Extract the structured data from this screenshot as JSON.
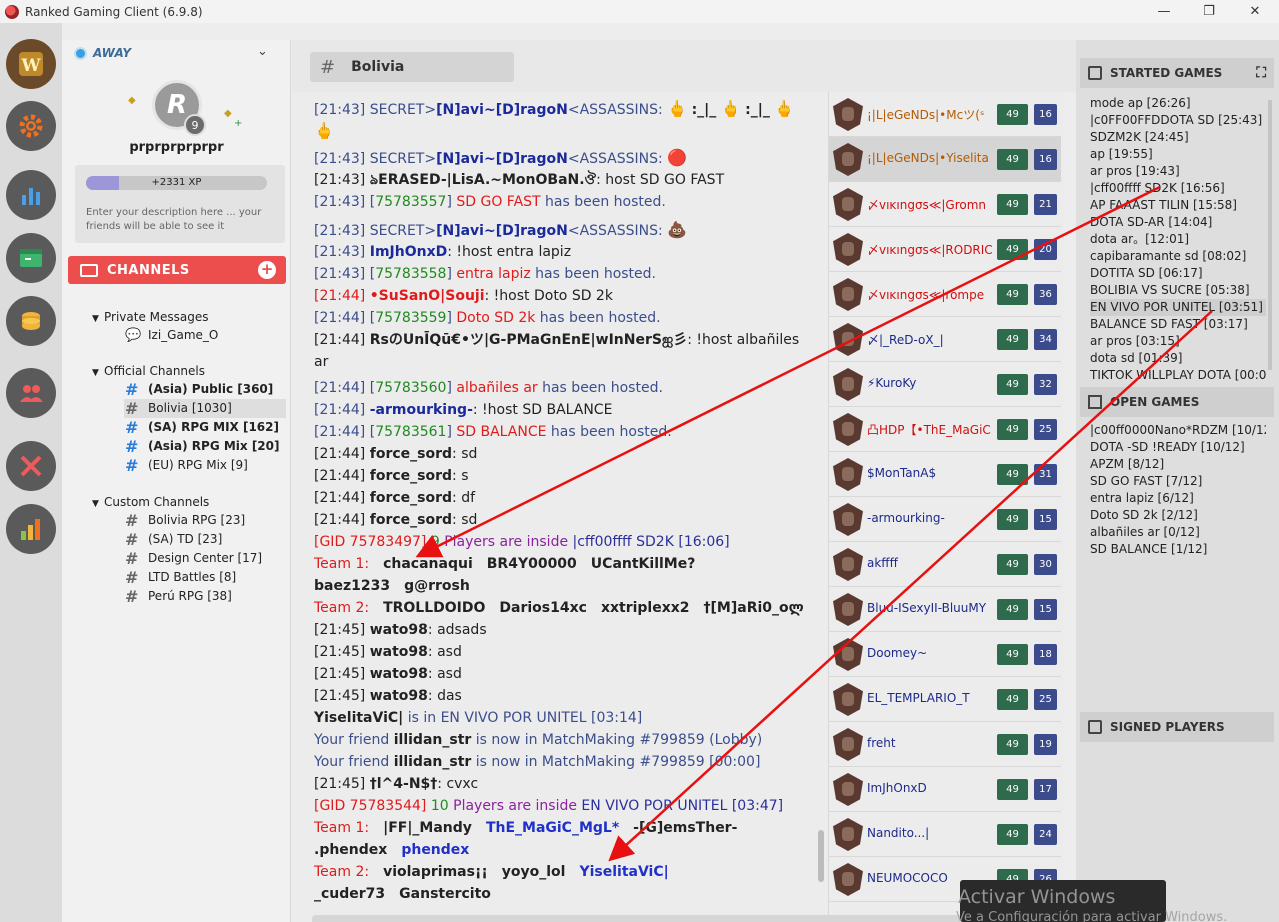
{
  "window": {
    "title": "Ranked Gaming Client (6.9.8)",
    "minimize": "—",
    "maximize": "❐",
    "close": "✕"
  },
  "profile": {
    "status": "AWAY",
    "avatar_letter": "R",
    "level": "9",
    "username": "prprprprprpr",
    "xp": "+2331 XP",
    "xp_progress": 0.18,
    "description_placeholder": "Enter your description here ... your friends will be able to see it"
  },
  "channels": {
    "header": "CHANNELS",
    "add": "+",
    "groups": [
      {
        "title": "Private Messages",
        "items": [
          "Izi_Game_O"
        ]
      },
      {
        "title": "Official Channels",
        "items": [
          "(Asia) Public [360]",
          "Bolivia [1030]",
          "(SA) RPG MIX [162]",
          "(Asia) RPG Mix [20]",
          "(EU) RPG Mix [9]"
        ]
      },
      {
        "title": "Custom Channels",
        "items": [
          "Bolivia RPG [23]",
          "(SA) TD [23]",
          "Design Center [17]",
          "LTD Battles [8]",
          "Perú RPG [38]"
        ]
      }
    ]
  },
  "chat": {
    "channel": "Bolivia",
    "hash": "#",
    "lines": {
      "l1a": "[21:43] SECRET>",
      "l1b": "[N]avi~[D]ragoN",
      "l1c": "<ASSASSINS:",
      "l1d": ":_|_",
      "l1e": ":_|_",
      "l2a": "[21:43] SECRET>",
      "l2b": "[N]avi~[D]ragoN",
      "l2c": "<ASSASSINS:",
      "l3a": "[21:43] ",
      "l3b": "ঌERASED-|LisA.~MonOBaN.ঔ",
      "l3c": ": host SD GO FAST",
      "l4a": "[21:43] [",
      "l4b": "75783557",
      "l4c": "] ",
      "l4d": "SD GO FAST",
      "l4e": " has been hosted.",
      "l5a": "[21:43] SECRET>",
      "l5b": "[N]avi~[D]ragoN",
      "l5c": "<ASSASSINS:",
      "l6a": "[21:43] ",
      "l6b": "ImJhOnxD",
      "l6c": ": !host entra lapiz",
      "l7a": "[21:43] [",
      "l7b": "75783558",
      "l7c": "] ",
      "l7d": "entra lapiz",
      "l7e": " has been hosted.",
      "l8a": "[21:44] ",
      "l8b": "•SuSanO|Souji",
      "l8c": ": !host Doto SD 2k",
      "l9a": "[21:44] [",
      "l9b": "75783559",
      "l9c": "] ",
      "l9d": "Doto SD 2k",
      "l9e": " has been hosted.",
      "l10a": "[21:44] ",
      "l10b": "RsのUnĪQū€•ツ|G-PMaGnEnE|wInNerSஐ彡",
      "l10c": ": !host albañiles ar",
      "l11a": "[21:44] [",
      "l11b": "75783560",
      "l11c": "] ",
      "l11d": "albañiles ar",
      "l11e": " has been hosted.",
      "l12a": "[21:44] ",
      "l12b": "-armourking-",
      "l12c": ": !host SD BALANCE",
      "l13a": "[21:44] [",
      "l13b": "75783561",
      "l13c": "] ",
      "l13d": "SD BALANCE",
      "l13e": " has been hosted.",
      "l14a": "[21:44] ",
      "l14b": "force_sord",
      "l14c": ": sd",
      "l15a": "[21:44] ",
      "l15b": "force_sord",
      "l15c": ": s",
      "l16a": "[21:44] ",
      "l16b": "force_sord",
      "l16c": ": df",
      "l17a": "[21:44] ",
      "l17b": "force_sord",
      "l17c": ": sd",
      "l18a": "[GID 75783497] ",
      "l18b": "9",
      "l18c": " Players are inside ",
      "l18d": "|cff00ffff ",
      "l18e": "SD2K",
      "l18f": " [16:06]",
      "l19a": "Team 1:",
      "l19b": "chacanaqui",
      "l19c": "BR4Y00000",
      "l19d": "UCantKillMe?",
      "l20a": "baez1233",
      "l20b": "g@rrosh",
      "l21a": "Team 2:",
      "l21b": "TROLLDOIDO",
      "l21c": "Darios14xc",
      "l21d": "xxtriplexx2",
      "l21e": "†[M]aRi0_oლ",
      "l22a": "[21:45] ",
      "l22b": "wato98",
      "l22c": ": adsads",
      "l23a": "[21:45] ",
      "l23b": "wato98",
      "l23c": ": asd",
      "l24a": "[21:45] ",
      "l24b": "wato98",
      "l24c": ": asd",
      "l25a": "[21:45] ",
      "l25b": "wato98",
      "l25c": ": das",
      "l26a": "YiselitaViC|",
      "l26b": " is in EN VIVO POR UNITEL [03:14]",
      "l27a": "Your friend ",
      "l27b": "illidan_str",
      "l27c": " is now in MatchMaking #799859 (Lobby)",
      "l28a": "Your friend ",
      "l28b": "illidan_str",
      "l28c": " is now in MatchMaking #799859 [00:00]",
      "l29a": "[21:45] ",
      "l29b": "†l^4-N$†",
      "l29c": ": cvxc",
      "l30a": "[GID 75783544] ",
      "l30b": "10",
      "l30c": " Players are inside ",
      "l30d": "EN VIVO POR UNITEL",
      "l30e": " [03:47]",
      "l31a": "Team 1:",
      "l31b": "|FF|_Mandy",
      "l31c": "ThE_MaGiC_MgL*",
      "l31d": "-[G]emsTher-",
      "l32a": ".phendex",
      "l32b": "phendex",
      "l33a": "Team 2:",
      "l33b": "violaprimas¡¡",
      "l33c": "yoyo_lol",
      "l33d": "YiselitaViC|",
      "l34a": "_cuder73",
      "l34b": "Ganstercito"
    }
  },
  "users": [
    {
      "name": "¡|L|eGeNDs|•Mcツ(ˢ",
      "color": "orange",
      "level": "49",
      "rank": "16"
    },
    {
      "name": "¡|L|eGeNDs|•Yiselita",
      "color": "orange",
      "level": "49",
      "rank": "16"
    },
    {
      "name": "〆vıĸıngσѕ≪|Gromn",
      "color": "red",
      "level": "49",
      "rank": "21"
    },
    {
      "name": "〆vıĸıngσѕ≪|RODRIC",
      "color": "red",
      "level": "49",
      "rank": "20"
    },
    {
      "name": "〆vıĸıngσѕ≪|rompe",
      "color": "red",
      "level": "49",
      "rank": "36"
    },
    {
      "name": "〆|_ReD-oX_|",
      "color": "blue",
      "level": "49",
      "rank": "34"
    },
    {
      "name": "⚡KuroKy",
      "color": "blue",
      "level": "49",
      "rank": "32"
    },
    {
      "name": "凸HDP【•ThE_MaGiC",
      "color": "red",
      "level": "49",
      "rank": "25"
    },
    {
      "name": "$MonTanA$",
      "color": "blue",
      "level": "49",
      "rank": "31"
    },
    {
      "name": "-armourking-",
      "color": "blue",
      "level": "49",
      "rank": "15"
    },
    {
      "name": "akffff",
      "color": "blue",
      "level": "49",
      "rank": "30"
    },
    {
      "name": "Bluu-ISexyII-BluuMY",
      "color": "blue",
      "level": "49",
      "rank": "15"
    },
    {
      "name": "Doomey~",
      "color": "blue",
      "level": "49",
      "rank": "18"
    },
    {
      "name": "EL_TEMPLARIO_T",
      "color": "blue",
      "level": "49",
      "rank": "25"
    },
    {
      "name": "freht",
      "color": "blue",
      "level": "49",
      "rank": "19"
    },
    {
      "name": "ImJhOnxD",
      "color": "blue",
      "level": "49",
      "rank": "17"
    },
    {
      "name": "Nandito...|",
      "color": "blue",
      "level": "49",
      "rank": "24"
    },
    {
      "name": "NEUMOCOCO",
      "color": "blue",
      "level": "49",
      "rank": "26"
    }
  ],
  "games": {
    "started_title": "STARTED GAMES",
    "started": [
      "mode ap [26:26]",
      "|c0FF00FFDDOTA SD [25:43]",
      "SDZM2K [24:45]",
      "ap [19:55]",
      "ar pros [19:43]",
      "|cff00ffff SD2K [16:56]",
      "AP FAAAST TILIN [15:58]",
      "DOTA SD-AR [14:04]",
      "dota ar。[12:01]",
      "capibaramante sd [08:02]",
      "DOTITA SD [06:17]",
      "BOLIBIA VS SUCRE [05:38]",
      "EN VIVO POR UNITEL [03:51]",
      "BALANCE SD FAST [03:17]",
      "ar pros [03:15]",
      "dota sd [01:39]",
      "TIKTOK WILLPLAY DOTA [00:0"
    ],
    "open_title": "OPEN GAMES",
    "open": [
      "|c00ff0000Nano*RDZM [10/12]",
      "DOTA -SD !READY [10/12]",
      "APZM [8/12]",
      "SD GO FAST [7/12]",
      "entra lapiz [6/12]",
      "Doto SD 2k [2/12]",
      "albañiles ar [0/12]",
      "SD BALANCE [1/12]"
    ],
    "signed_title": "SIGNED PLAYERS"
  },
  "watermark": {
    "title": "Activar Windows",
    "subtitle": "Ve a Configuración para activar Windows."
  },
  "colors": {
    "accent": "#ec4d4d",
    "level_badge": "#2e6b4c",
    "rank_badge": "#3c4b8c",
    "arrow": "#e81010"
  }
}
